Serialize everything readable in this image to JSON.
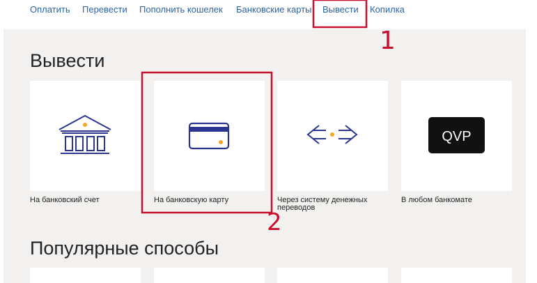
{
  "nav": {
    "items": [
      "Оплатить",
      "Перевести",
      "Пополнить кошелек",
      "Банковские карты",
      "Вывести",
      "Копилка"
    ]
  },
  "withdraw": {
    "title": "Вывести",
    "options": [
      {
        "label": "На банковский счет",
        "icon": "bank-icon"
      },
      {
        "label": "На банковскую карту",
        "icon": "credit-card-icon"
      },
      {
        "label": "Через систему денежных переводов",
        "icon": "transfer-arrows-icon"
      },
      {
        "label": "В любом банкомате",
        "icon": "qvp-icon",
        "icon_text": "QVP"
      }
    ]
  },
  "popular": {
    "title": "Популярные способы"
  },
  "annotations": {
    "marker_1": "1",
    "marker_2": "2"
  },
  "colors": {
    "link": "#2a63a8",
    "icon_navy": "#2b3590",
    "icon_accent": "#f5a623",
    "annotation": "#c8102e",
    "panel_bg": "#f2f1ef"
  }
}
